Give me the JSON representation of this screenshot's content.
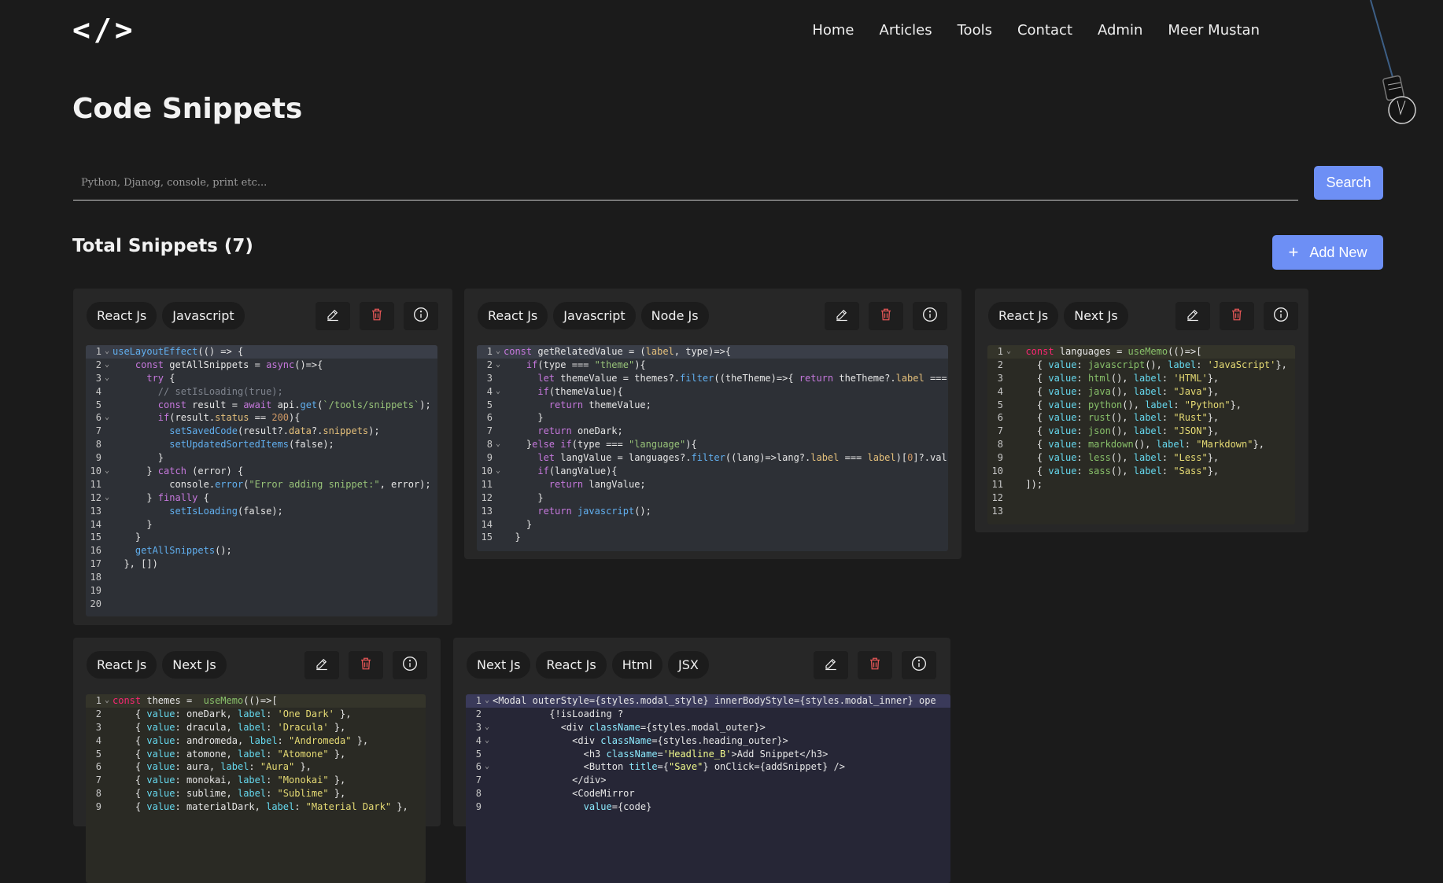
{
  "logo": "</>",
  "nav": [
    "Home",
    "Articles",
    "Tools",
    "Contact",
    "Admin",
    "Meer Mustan"
  ],
  "title": "Code Snippets",
  "search": {
    "placeholder": "Python, Djanog, console, print etc...",
    "button": "Search"
  },
  "total": "Total Snippets (7)",
  "add_button": "Add New",
  "colors": {
    "accent": "#6d8ff5",
    "background": "#1b1b1b",
    "card": "#272727",
    "delete": "#e05555"
  },
  "icons": {
    "edit": "pencil-icon",
    "delete": "trash-icon",
    "info": "info-icon",
    "add": "plus-icon"
  },
  "cards": [
    {
      "tags": [
        "React Js",
        "Javascript"
      ],
      "lines": [
        "useLayoutEffect(() => {",
        "    const getAllSnippets = async()=>{",
        "      try {",
        "        // setIsLoading(true);",
        "        const result = await api.get(`/tools/snippets`);",
        "        if(result.status == 200){",
        "          setSavedCode(result?.data?.snippets);",
        "          setUpdatedSortedItems(false);",
        "        }",
        "      } catch (error) {",
        "          console.error(\"Error adding snippet:\", error);",
        "      } finally {",
        "          setIsLoading(false);",
        "      }",
        "    }",
        "    getAllSnippets();",
        "  }, [])",
        "",
        "",
        ""
      ]
    },
    {
      "tags": [
        "React Js",
        "Javascript",
        "Node Js"
      ],
      "lines": [
        "const getRelatedValue = (label, type)=>{",
        "    if(type === \"theme\"){",
        "      let themeValue = themes?.filter((theTheme)=>{ return theTheme?.label === ",
        "      if(themeValue){",
        "        return themeValue;",
        "      }",
        "      return oneDark;",
        "    }else if(type === \"language\"){",
        "      let langValue = languages?.filter((lang)=>lang?.label === label)[0]?.val",
        "      if(langValue){",
        "        return langValue;",
        "      }",
        "      return javascript();",
        "    }",
        "  }"
      ]
    },
    {
      "tags": [
        "React Js",
        "Next Js"
      ],
      "lines": [
        "  const languages = useMemo(()=>[",
        "    { value: javascript(), label: 'JavaScript'},",
        "    { value: html(), label: 'HTML'},",
        "    { value: java(), label: \"Java\"},",
        "    { value: python(), label: \"Python\"},",
        "    { value: rust(), label: \"Rust\"},",
        "    { value: json(), label: \"JSON\"},",
        "    { value: markdown(), label: \"Markdown\"},",
        "    { value: less(), label: \"Less\"},",
        "    { value: sass(), label: \"Sass\"},",
        "  ]);",
        "",
        ""
      ]
    },
    {
      "tags": [
        "React Js",
        "Next Js"
      ],
      "lines": [
        "const themes =  useMemo(()=>[",
        "    { value: oneDark, label: 'One Dark' },",
        "    { value: dracula, label: 'Dracula' },",
        "    { value: andromeda, label: \"Andromeda\" },",
        "    { value: atomone, label: \"Atomone\" },",
        "    { value: aura, label: \"Aura\" },",
        "    { value: monokai, label: \"Monokai\" },",
        "    { value: sublime, label: \"Sublime\" },",
        "    { value: materialDark, label: \"Material Dark\" },"
      ]
    },
    {
      "tags": [
        "Next Js",
        "React Js",
        "Html",
        "JSX"
      ],
      "lines": [
        "<Modal outerStyle={styles.modal_style} innerBodyStyle={styles.modal_inner} ope",
        "          {!isLoading ?",
        "            <div className={styles.modal_outer}>",
        "              <div className={styles.heading_outer}>",
        "                <h3 className='Headline_B'>Add Snippet</h3>",
        "                <Button title={\"Save\"} onClick={addSnippet} />",
        "              </div>",
        "              <CodeMirror",
        "                value={code}"
      ]
    }
  ]
}
